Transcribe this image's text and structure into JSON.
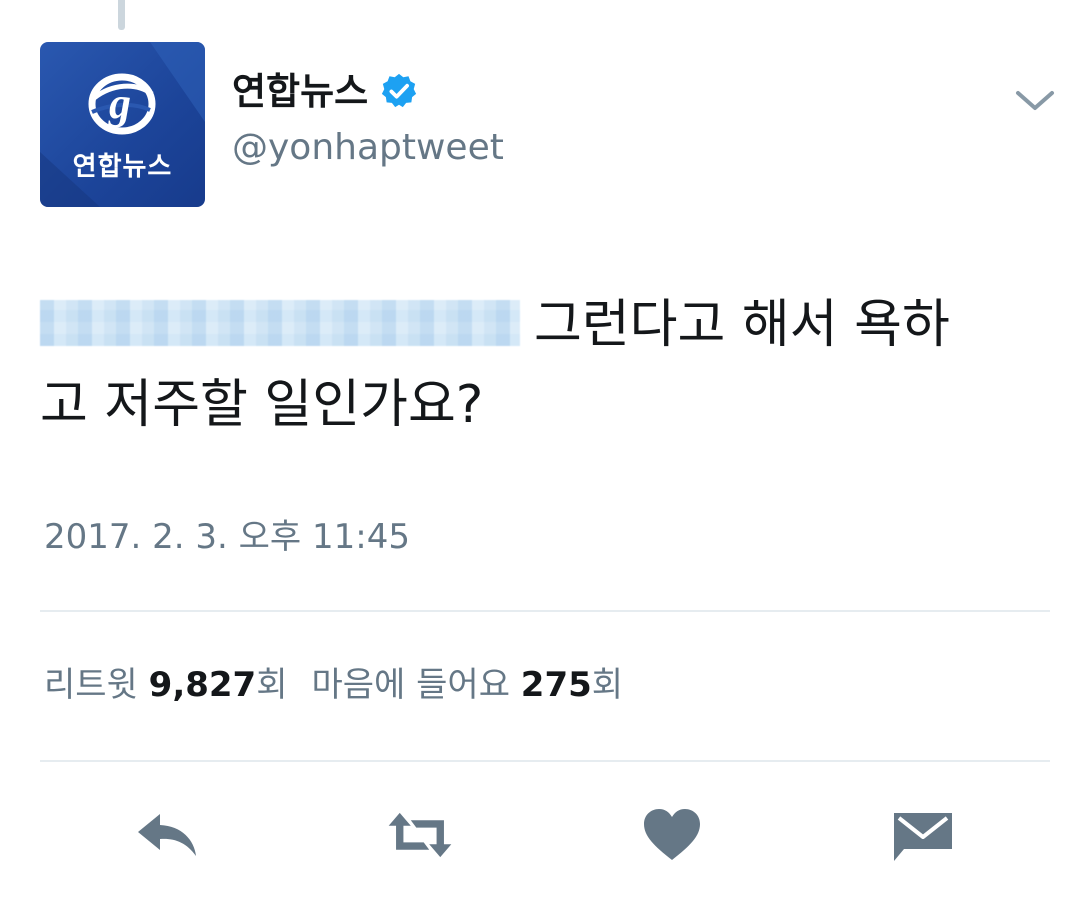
{
  "account": {
    "display_name": "연합뉴스",
    "handle": "@yonhaptweet",
    "avatar_text": "연합뉴스",
    "verified": true
  },
  "tweet": {
    "text_suffix_line1": "그런다고 해서 욕하",
    "text_line2": "고 저주할 일인가요?",
    "timestamp": "2017. 2. 3. 오후 11:45"
  },
  "stats": {
    "retweet_label": "리트윗",
    "retweet_count": "9,827",
    "retweet_unit": "회",
    "like_label": "마음에 들어요",
    "like_count": "275",
    "like_unit": "회"
  },
  "actions": [
    {
      "name": "reply",
      "icon": "reply-icon"
    },
    {
      "name": "retweet",
      "icon": "retweet-icon"
    },
    {
      "name": "like",
      "icon": "heart-icon"
    },
    {
      "name": "message",
      "icon": "envelope-icon"
    }
  ],
  "colors": {
    "text_primary": "#14171a",
    "text_secondary": "#657786",
    "verified_blue": "#1da1f2",
    "avatar_blue": "#1c4499",
    "icon_gray": "#657786",
    "divider": "#e6ecf0"
  }
}
